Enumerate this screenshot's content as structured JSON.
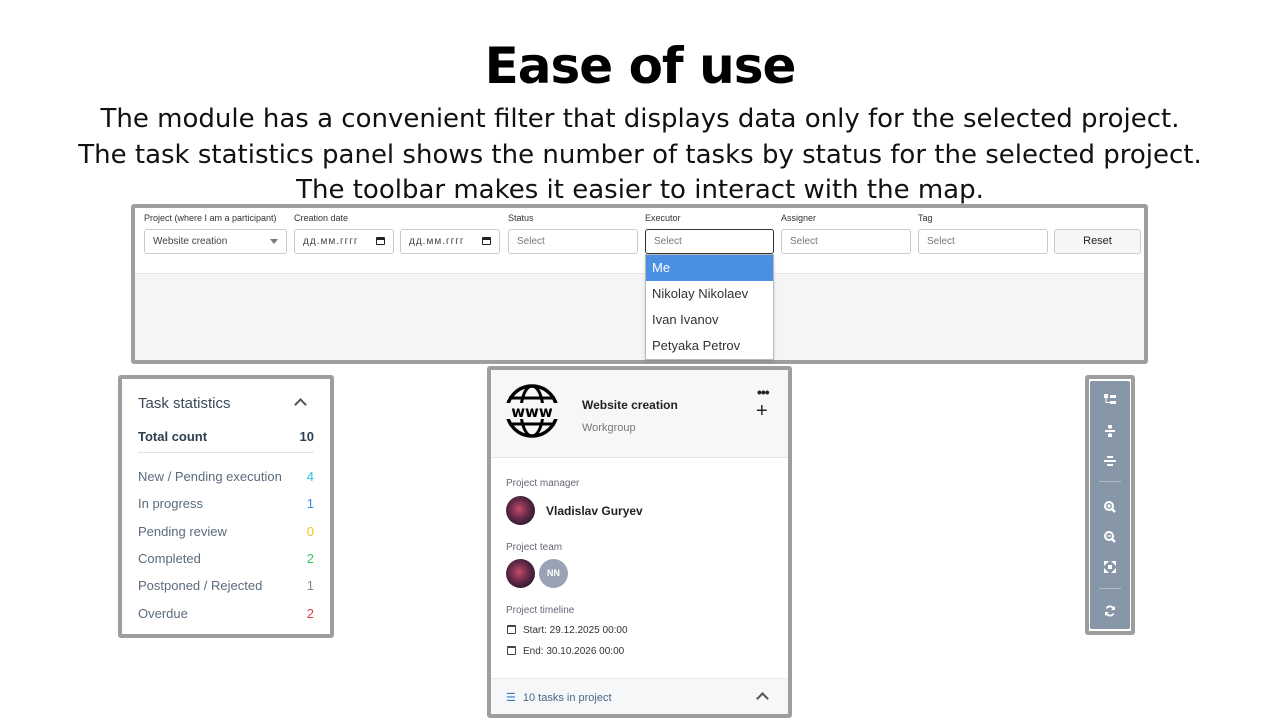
{
  "heading": {
    "title": "Ease of use",
    "lines": [
      "The module has a convenient filter that displays data only for the selected project.",
      "The task statistics panel shows the number of tasks by status for the selected project.",
      "The toolbar makes it easier to interact with the map."
    ]
  },
  "filters": {
    "project_label": "Project (where I am a participant)",
    "project_value": "Website creation",
    "creation_date_label": "Creation date",
    "date_from_value": "дд.мм.гггг",
    "date_to_value": "дд.мм.гггг",
    "status_label": "Status",
    "status_placeholder": "Select",
    "executor_label": "Executor",
    "executor_placeholder": "Select",
    "assigner_label": "Assigner",
    "assigner_placeholder": "Select",
    "tag_label": "Tag",
    "tag_placeholder": "Select",
    "reset_label": "Reset",
    "executor_options": [
      "Me",
      "Nikolay Nikolaev",
      "Ivan Ivanov",
      "Petyaka Petrov"
    ],
    "executor_highlighted": "Me"
  },
  "stats": {
    "title": "Task statistics",
    "total_label": "Total count",
    "total_value": "10",
    "rows": [
      {
        "label": "New / Pending execution",
        "value": "4",
        "color": "#1ec9e0"
      },
      {
        "label": "In progress",
        "value": "1",
        "color": "#3a8fd9"
      },
      {
        "label": "Pending review",
        "value": "0",
        "color": "#f0c419"
      },
      {
        "label": "Completed",
        "value": "2",
        "color": "#34c759"
      },
      {
        "label": "Postponed / Rejected",
        "value": "1",
        "color": "#7f8c9a"
      },
      {
        "label": "Overdue",
        "value": "2",
        "color": "#e0403b"
      }
    ]
  },
  "project_card": {
    "name": "Website creation",
    "type": "Workgroup",
    "more_icon": "ellipsis-icon",
    "add_icon": "plus-icon",
    "manager_label": "Project manager",
    "manager_name": "Vladislav Guryev",
    "team_label": "Project team",
    "team_initials": "NN",
    "timeline_label": "Project timeline",
    "start": "Start: 29.12.2025 00:00",
    "end": "End: 30.10.2026 00:00",
    "tasks_footer": "10 tasks in project"
  },
  "toolbar": {
    "buttons": [
      "hierarchy-icon",
      "collapse-icon",
      "center-icon",
      "zoom-in-icon",
      "zoom-out-icon",
      "fit-screen-icon",
      "refresh-icon"
    ]
  }
}
